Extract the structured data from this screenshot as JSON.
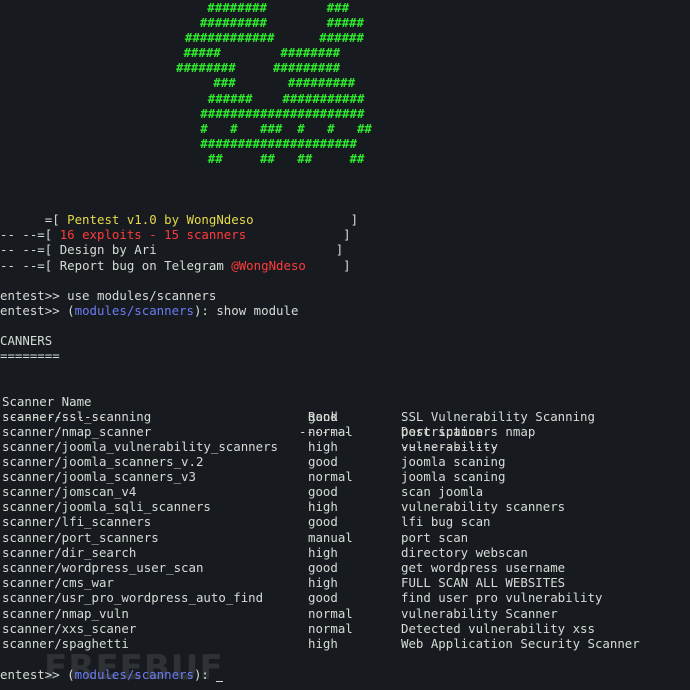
{
  "ascii_art": [
    "     ########        ###",
    "    #########        #####",
    "  ############      ######",
    " #####        ########",
    "########     #########",
    "     ###       #########",
    "      ######    ###########",
    "     ######################",
    "     #   #   ###  #   #   ##",
    "     #####################",
    "      ##     ##   ##     ##"
  ],
  "banner": {
    "line1_prefix": "      =[ ",
    "line1_text": "Pentest v1.0 by WongNdeso",
    "line1_suffix": "             ]",
    "line2_prefix": "-- --=[ ",
    "line2_text": "16 exploits - 15 scanners",
    "line2_suffix": "             ]",
    "line3_prefix": "-- --=[ ",
    "line3_text": "Design by Ari",
    "line3_suffix": "                        ]",
    "line4_prefix": "-- --=[ ",
    "line4_text": "Report bug on Telegram ",
    "line4_handle": "@WongNdeso",
    "line4_suffix": "     ]"
  },
  "commands": {
    "cmd1_prompt": "entest>> ",
    "cmd1_text": "use modules/scanners",
    "cmd2_prompt": "entest>> (",
    "cmd2_module": "modules/scanners",
    "cmd2_text": "): show module"
  },
  "section": {
    "title": "CANNERS",
    "underline": "========"
  },
  "table": {
    "headers": {
      "name": "Scanner Name",
      "rank": "Rank",
      "desc": "Description"
    },
    "separators": {
      "name": "--------------",
      "rank": "-------",
      "desc": "-------------"
    },
    "rows": [
      {
        "name": "scanner/ssl_scanning",
        "rank": "good",
        "desc": "SSL Vulnerability Scanning"
      },
      {
        "name": "scanner/nmap_scanner",
        "rank": "normal",
        "desc": "port scanners nmap"
      },
      {
        "name": "scanner/joomla_vulnerability_scanners",
        "rank": "high",
        "desc": "vulnerability"
      },
      {
        "name": "scanner/joomla_scanners_v.2",
        "rank": "good",
        "desc": "joomla scaning"
      },
      {
        "name": "scanner/joomla_scanners_v3",
        "rank": "normal",
        "desc": "joomla scaning"
      },
      {
        "name": "scanner/jomscan_v4",
        "rank": "good",
        "desc": "scan joomla"
      },
      {
        "name": "scanner/joomla_sqli_scanners",
        "rank": "high",
        "desc": "vulnerability scanners"
      },
      {
        "name": "scanner/lfi_scanners",
        "rank": "good",
        "desc": "lfi bug scan"
      },
      {
        "name": "scanner/port_scanners",
        "rank": "manual",
        "desc": "port scan"
      },
      {
        "name": "scanner/dir_search",
        "rank": "high",
        "desc": "directory webscan"
      },
      {
        "name": "scanner/wordpress_user_scan",
        "rank": "good",
        "desc": "get wordpress username"
      },
      {
        "name": "scanner/cms_war",
        "rank": "high",
        "desc": "FULL SCAN ALL WEBSITES"
      },
      {
        "name": "scanner/usr_pro_wordpress_auto_find",
        "rank": "good",
        "desc": "find user pro vulnerability"
      },
      {
        "name": "scanner/nmap_vuln",
        "rank": "normal",
        "desc": "vulnerability Scanner"
      },
      {
        "name": "scanner/xxs_scaner",
        "rank": "normal",
        "desc": "Detected vulnerability xss"
      },
      {
        "name": "scanner/spaghetti",
        "rank": "high",
        "desc": "Web Application Security Scanner"
      }
    ]
  },
  "prompt_final": {
    "prefix": "entest>> (",
    "module": "modules/scanners",
    "suffix": "): "
  },
  "watermark": "FREEBUF",
  "colors": {
    "background": "#171b1f",
    "ascii": "#2ee82e",
    "yellow": "#e6d84a",
    "red": "#ff3b3b",
    "blue": "#6b7cf2"
  }
}
